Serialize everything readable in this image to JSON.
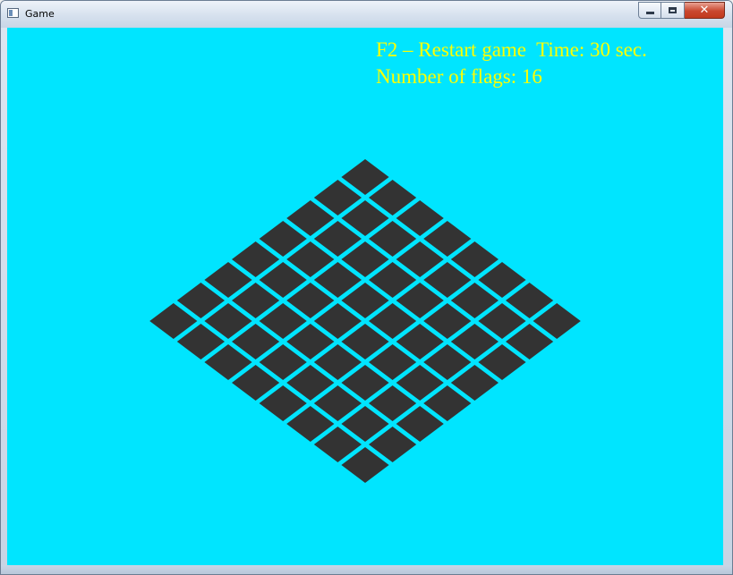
{
  "window": {
    "title": "Game",
    "buttons": {
      "minimize_icon": "minimize-icon",
      "maximize_icon": "maximize-icon",
      "close_icon": "close-icon",
      "close_glyph": "✕"
    }
  },
  "hud": {
    "restart_text": "F2 – Restart game",
    "time_text": "Time: 30 sec.",
    "flags_text": "Number of flags: 16"
  },
  "board": {
    "rows": 8,
    "cols": 8,
    "cell_color": "#333333",
    "grid_line_color": "#00e5ff"
  },
  "colors": {
    "background": "#00e5ff",
    "hud_text": "#ffff00"
  }
}
